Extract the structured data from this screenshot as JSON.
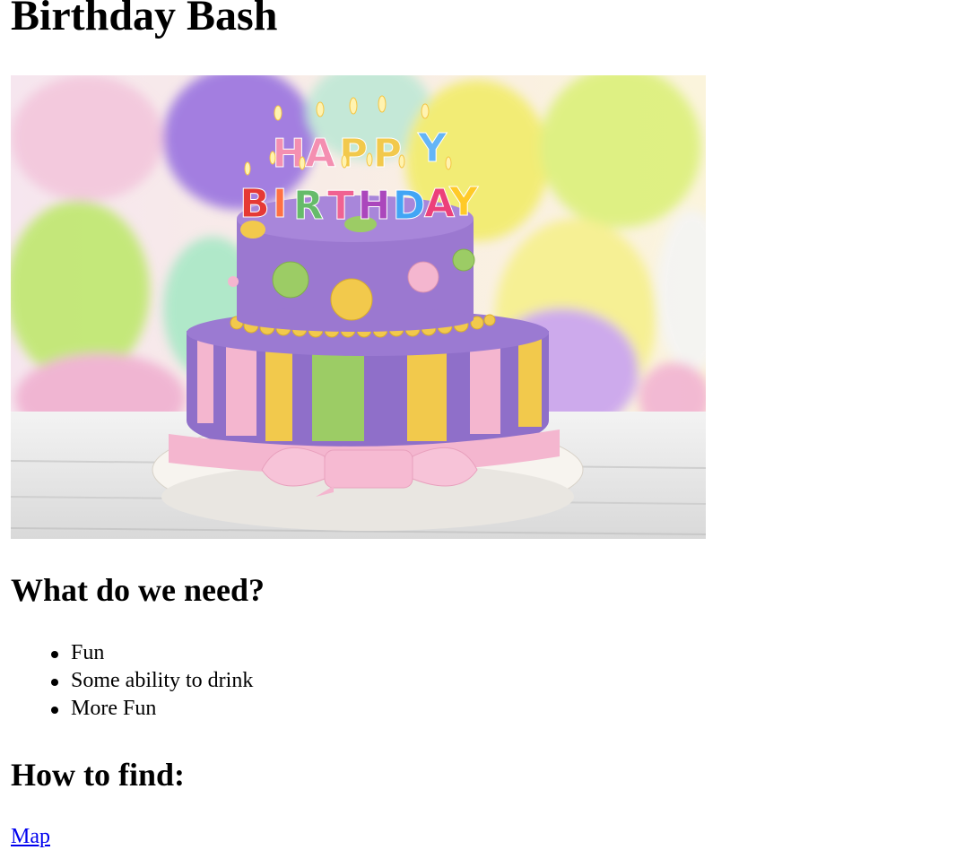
{
  "page": {
    "title": "Birthday Bash",
    "hero_image": {
      "alt": "Two-tier birthday cake with HAPPY BIRTHDAY candles and balloons",
      "candles_text": [
        "HAPPY",
        "BIRTHDAY"
      ]
    },
    "needs_heading": "What do we need?",
    "needs": [
      "Fun",
      "Some ability to drink",
      "More Fun"
    ],
    "find_heading": "How to find:",
    "map_link": "Map"
  },
  "colors": {
    "link": "#0000ee",
    "cake_purple": "#8f6fc9",
    "cake_pink": "#f4b6cf",
    "cake_yellow": "#f2c94c",
    "cake_green": "#9ccc65"
  }
}
